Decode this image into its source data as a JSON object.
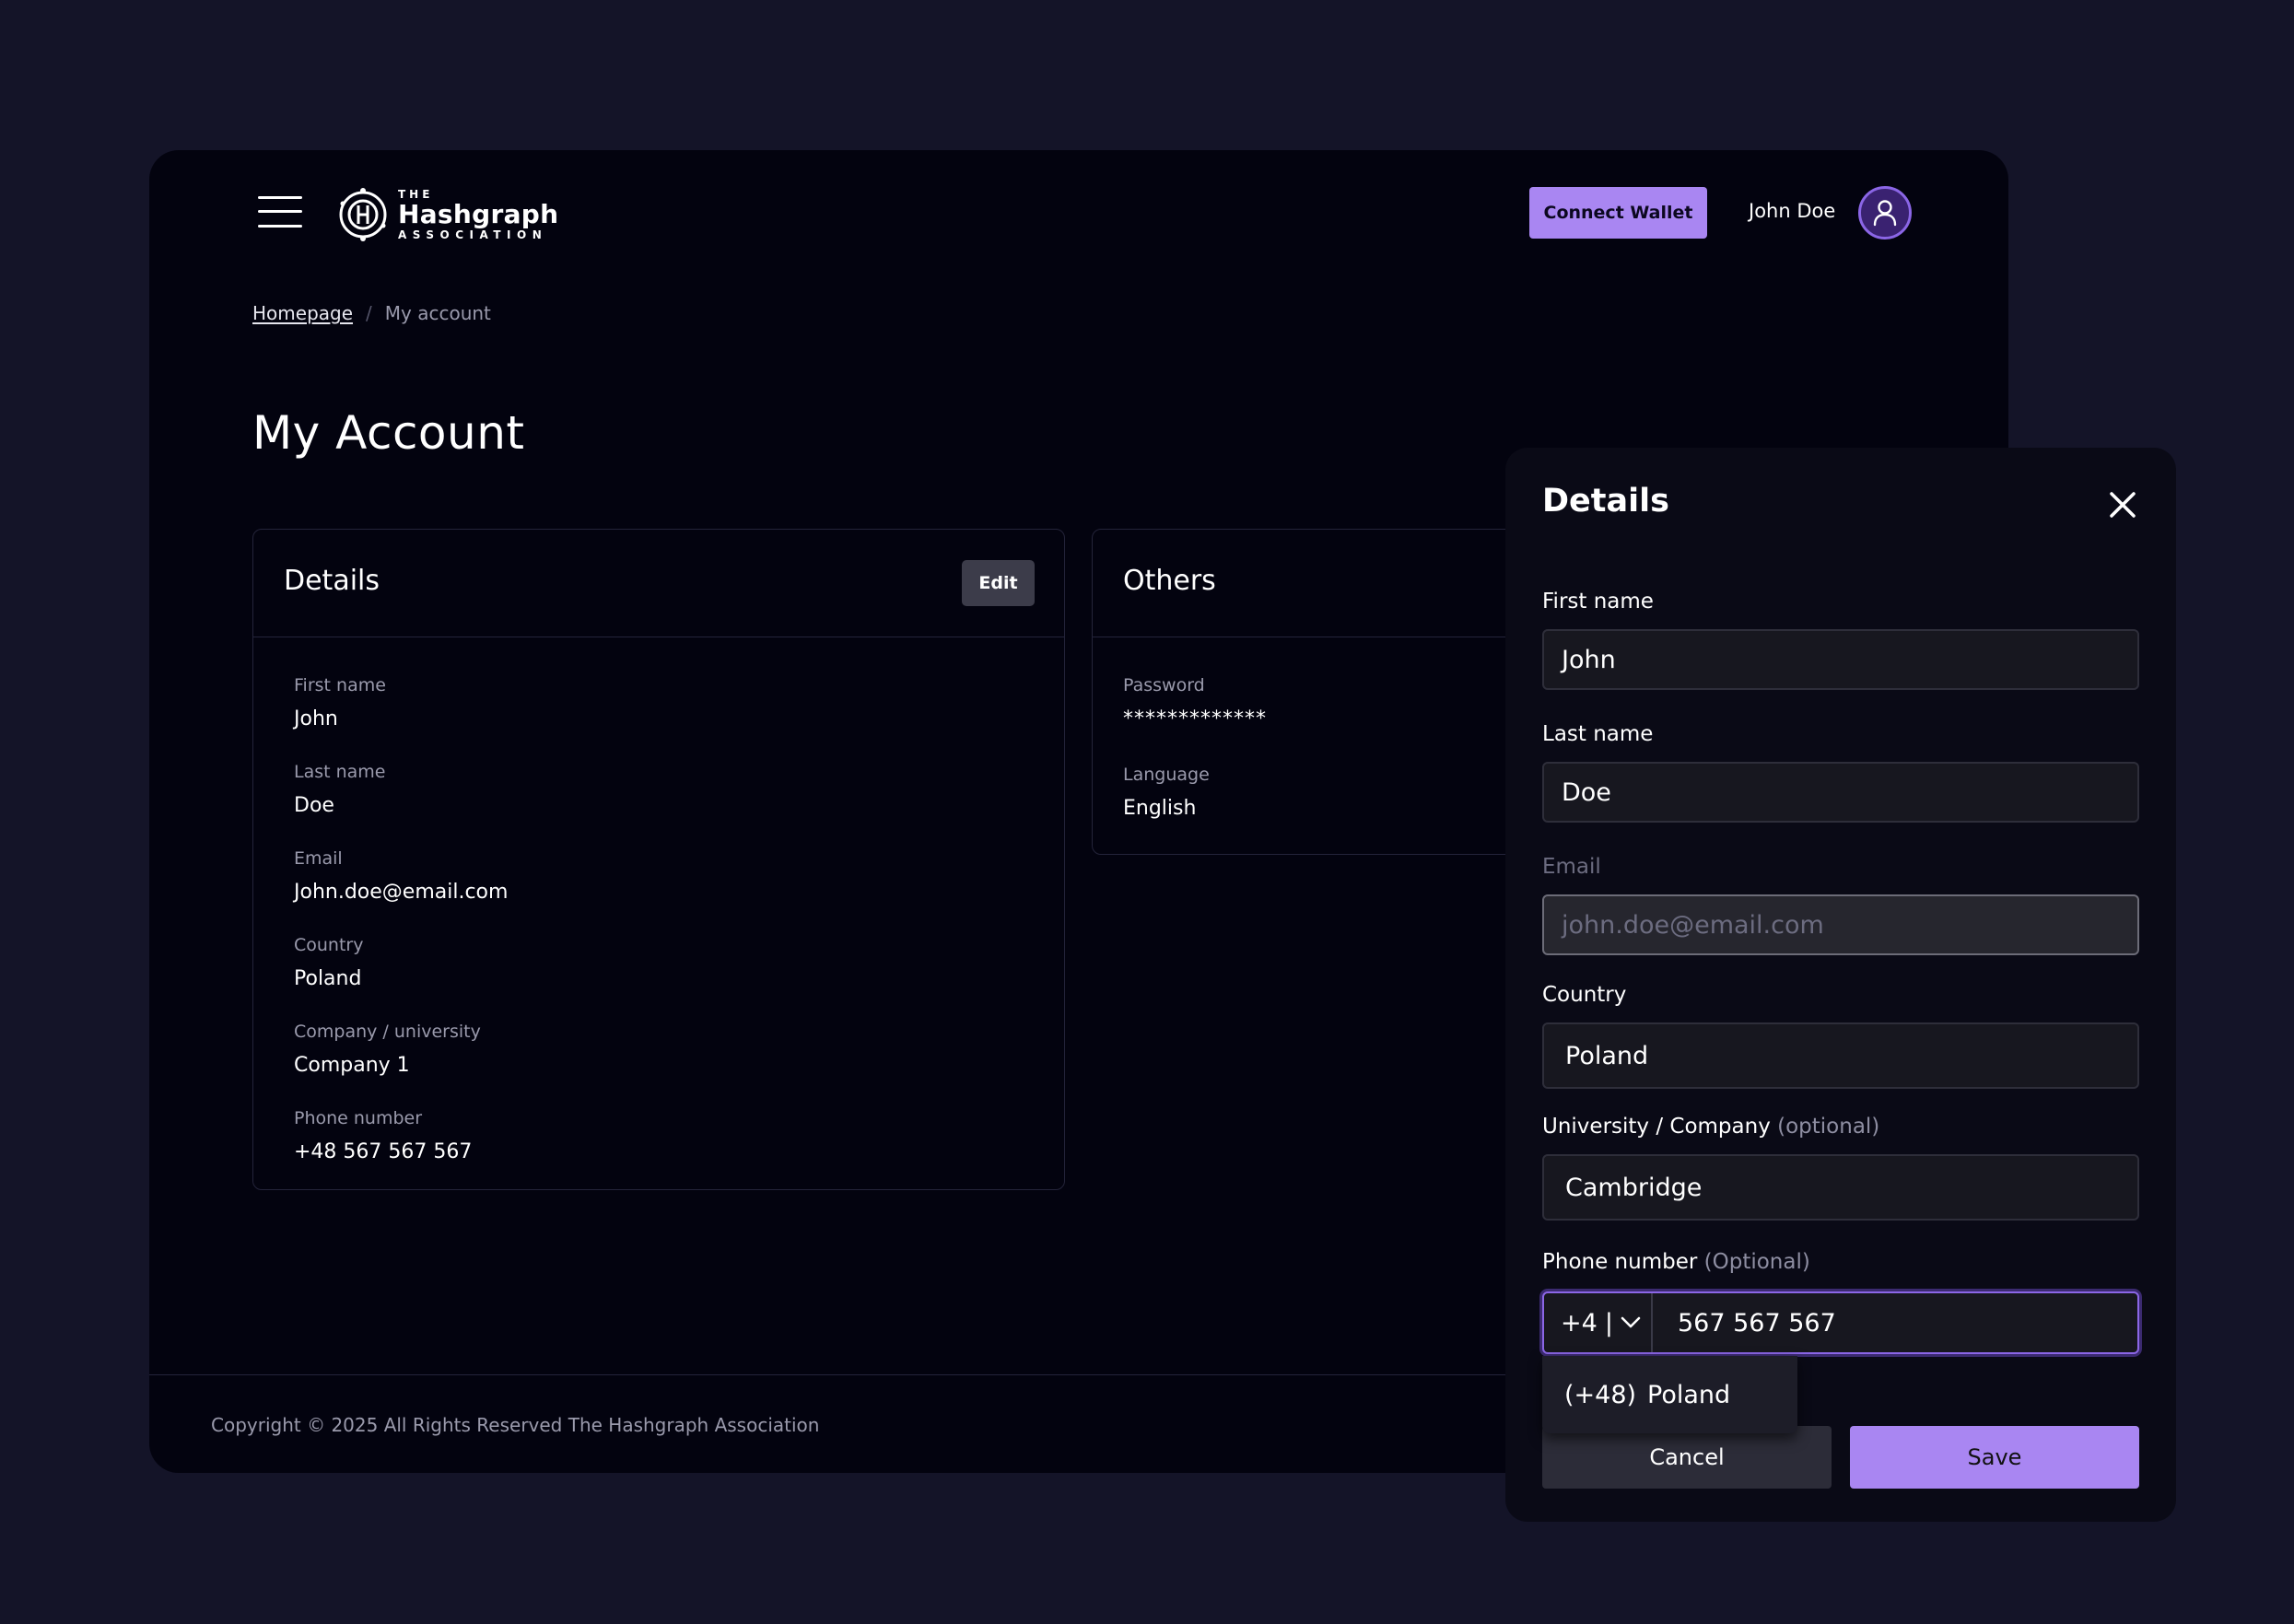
{
  "header": {
    "logo": {
      "line1": "THE",
      "line2": "Hashgraph",
      "line3": "ASSOCIATION"
    },
    "connect_wallet": "Connect Wallet",
    "user_name": "John Doe"
  },
  "breadcrumb": {
    "home": "Homepage",
    "separator": "/",
    "current": "My account"
  },
  "page_title": "My Account",
  "details_card": {
    "title": "Details",
    "edit": "Edit",
    "fields": [
      {
        "label": "First name",
        "value": "John"
      },
      {
        "label": "Last name",
        "value": "Doe"
      },
      {
        "label": "Email",
        "value": "John.doe@email.com"
      },
      {
        "label": "Country",
        "value": "Poland"
      },
      {
        "label": "Company / university",
        "value": "Company 1"
      },
      {
        "label": "Phone number",
        "value": "+48 567 567 567"
      }
    ]
  },
  "others_card": {
    "title": "Others",
    "fields": [
      {
        "label": "Password",
        "value": "*************"
      },
      {
        "label": "Language",
        "value": "English"
      }
    ]
  },
  "footer": {
    "copyright": "Copyright © 2025 All Rights Reserved The Hashgraph Association"
  },
  "modal": {
    "title": "Details",
    "first_name": {
      "label": "First name",
      "value": "John"
    },
    "last_name": {
      "label": "Last name",
      "value": "Doe"
    },
    "email": {
      "label": "Email",
      "placeholder": "john.doe@email.com"
    },
    "country": {
      "label": "Country",
      "value": "Poland"
    },
    "company": {
      "label": "University / Company",
      "optional": "(optional)",
      "value": "Cambridge"
    },
    "phone": {
      "label": "Phone number",
      "optional": "(Optional)",
      "code": "+4",
      "separator": "|",
      "number": "567 567 567"
    },
    "dropdown": {
      "code": "(+48)",
      "country": "Poland"
    },
    "cancel": "Cancel",
    "save": "Save"
  },
  "colors": {
    "accent": "#a986f2",
    "background": "#141428",
    "panel": "#03030f",
    "modal": "#0a0a16"
  }
}
